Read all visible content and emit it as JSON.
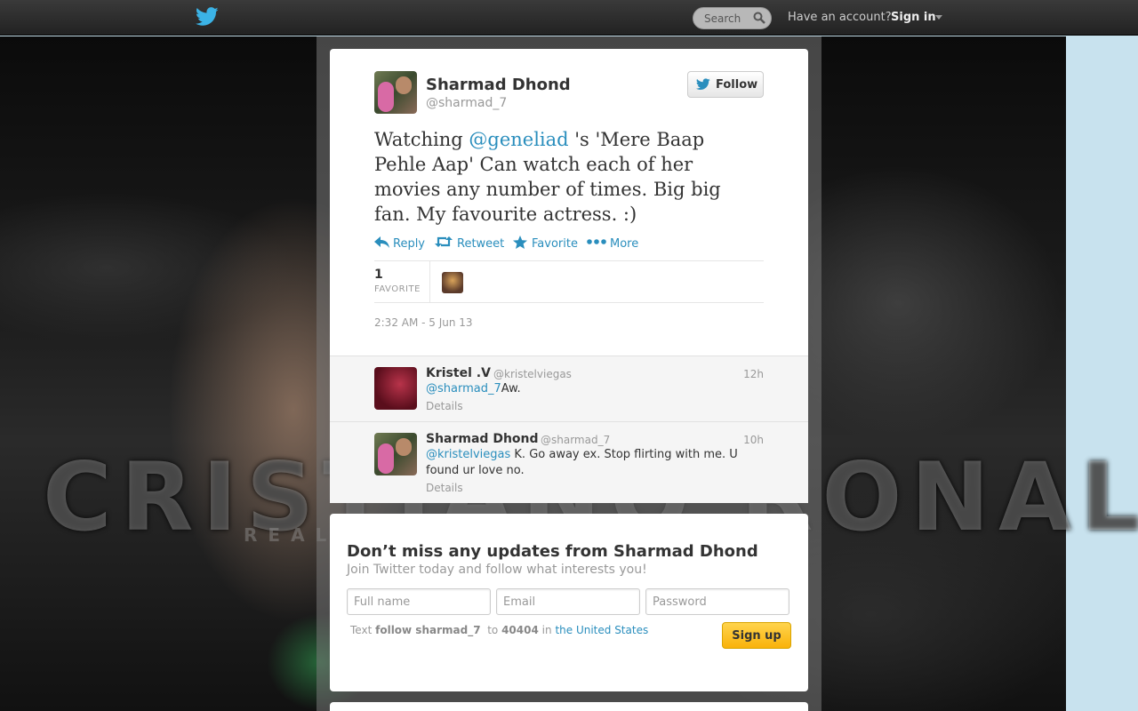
{
  "topbar": {
    "search_placeholder": "Search",
    "have_account": "Have an account?",
    "sign_in": "Sign in"
  },
  "background": {
    "word": "CRISTIANO RONALDO",
    "sub": "REAL MADRID"
  },
  "tweet": {
    "author_name": "Sharmad Dhond",
    "author_handle": "@sharmad_7",
    "follow_label": "Follow",
    "text_before": "Watching ",
    "mention": "@geneliad",
    "text_after": " 's 'Mere Baap Pehle Aap'  Can watch each of her movies any number of times. Big big fan. My favourite actress. :)",
    "actions": {
      "reply": "Reply",
      "retweet": "Retweet",
      "favorite": "Favorite",
      "more": "More"
    },
    "favorite_count": "1",
    "favorite_label": "FAVORITE",
    "timestamp": "2:32 AM - 5 Jun 13"
  },
  "replies": [
    {
      "name": "Kristel .V",
      "handle": "@kristelviegas",
      "time": "12h",
      "mention": "@sharmad_7",
      "text": "Aw.",
      "details": "Details"
    },
    {
      "name": "Sharmad Dhond",
      "handle": "@sharmad_7",
      "time": "10h",
      "mention": "@kristelviegas",
      "text": " K.  Go away ex. Stop flirting with me. U found ur love no.",
      "details": "Details"
    }
  ],
  "signup": {
    "title": "Don’t miss any updates from Sharmad Dhond",
    "subtitle": "Join Twitter today and follow what interests you!",
    "full_name_placeholder": "Full name",
    "email_placeholder": "Email",
    "password_placeholder": "Password",
    "sms_text": "Text",
    "sms_command": "follow sharmad_7",
    "sms_to": "to",
    "sms_number": "40404",
    "sms_in": "in",
    "sms_country": "the United States",
    "button": "Sign up"
  },
  "colors": {
    "link": "#2a8ebd",
    "signup_button": "#f9b20a",
    "topbar": "#2a2a2a"
  }
}
